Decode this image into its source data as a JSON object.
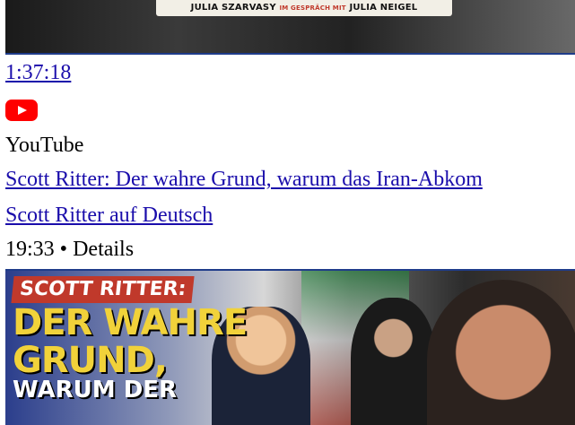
{
  "prev_video": {
    "thumbnail_caption": {
      "left": "JULIA SZARVASY",
      "middle": "IM GESPRÄCH MIT",
      "right": "JULIA NEIGEL"
    },
    "duration": "1:37:18"
  },
  "result": {
    "source_icon": "youtube-icon",
    "source": "YouTube",
    "title": "Scott Ritter: Der wahre Grund, warum das Iran-Abkom",
    "channel": "Scott Ritter auf Deutsch",
    "duration": "19:33",
    "separator": "•",
    "details_label": "Details",
    "thumbnail": {
      "kicker": "SCOTT RITTER:",
      "line1": "DER WAHRE",
      "line2": "GRUND,",
      "line3": "WARUM DER"
    }
  },
  "colors": {
    "link": "#1a0dab",
    "youtube_red": "#ff0000",
    "headline_yellow": "#f1d23a",
    "kicker_red": "#c0392b"
  }
}
